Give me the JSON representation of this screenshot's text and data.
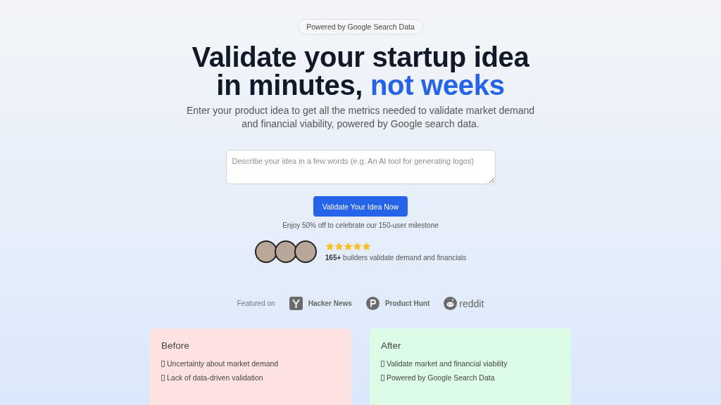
{
  "badge": "Powered by Google Search Data",
  "headline": {
    "line1": "Validate your startup idea",
    "line2_start": "in minutes,",
    "line2_accent": "not weeks"
  },
  "subtitle": "Enter your product idea to get all the metrics needed to validate market demand and financial viability, powered by Google search data.",
  "idea_field": {
    "placeholder": "Describe your idea in a few words (e.g. An AI tool for generating logos)"
  },
  "cta_button": "Validate Your Idea Now",
  "promo": "Enjoy 50% off to celebrate our 150-user milestone",
  "social_proof": {
    "stars": 5,
    "text": "**165+** builders validate demand and financials"
  },
  "featured": {
    "label": "Featured on",
    "items": [
      {
        "kind": "yc",
        "name": "Hacker News"
      },
      {
        "kind": "ph",
        "name": "Product Hunt"
      },
      {
        "kind": "reddit",
        "name": "reddit"
      }
    ]
  },
  "comparison": [
    {
      "kind": "before",
      "title": "Before",
      "items": [
        "Uncertainty about market demand",
        "Lack of data-driven validation"
      ]
    },
    {
      "kind": "after",
      "title": "After",
      "items": [
        "Validate market and financial viability",
        "Powered by Google Search Data"
      ]
    }
  ]
}
